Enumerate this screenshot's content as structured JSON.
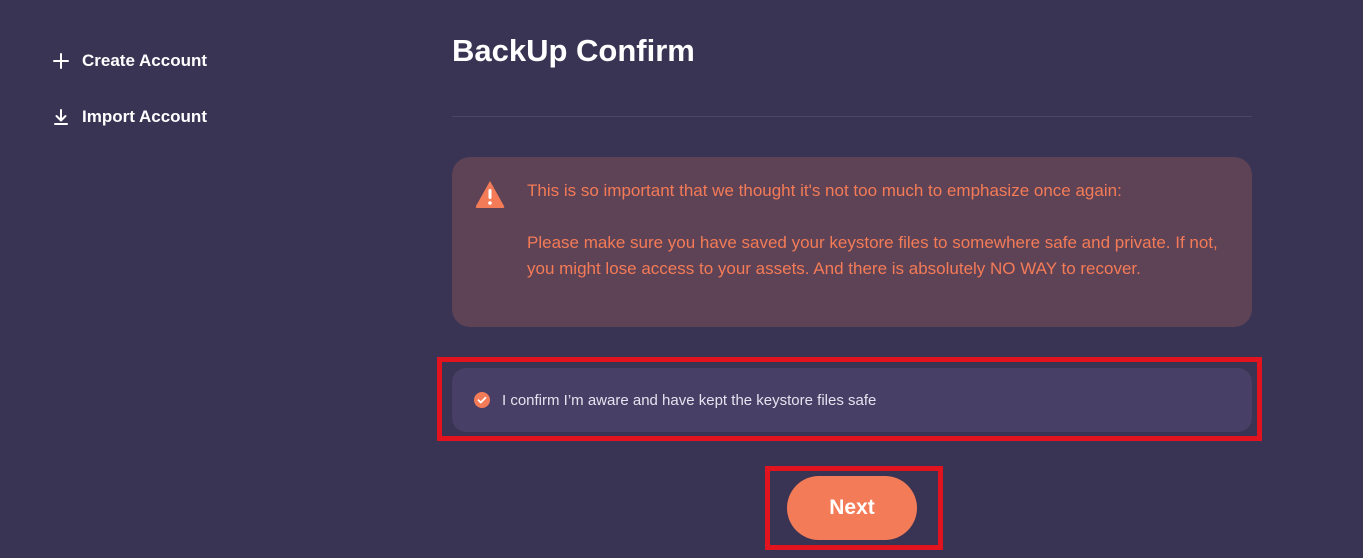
{
  "sidebar": {
    "items": [
      {
        "label": "Create Account",
        "icon": "plus-icon"
      },
      {
        "label": "Import Account",
        "icon": "download-icon"
      }
    ]
  },
  "main": {
    "title": "BackUp Confirm",
    "warning": {
      "icon": "warning-triangle-icon",
      "line1": "This is so important that we thought it's not too much to emphasize once again:",
      "line2": "Please make sure you have saved your keystore files to somewhere safe and private. If not, you might lose access to your assets. And there is absolutely NO WAY to recover."
    },
    "confirm": {
      "label": "I confirm I’m aware and have kept the keystore files safe",
      "checked": true
    },
    "next_label": "Next"
  },
  "colors": {
    "background": "#393354",
    "accent": "#f47b57",
    "warning_bg": "#5e4255",
    "confirm_bg": "#473f65",
    "highlight": "#e0131f"
  }
}
